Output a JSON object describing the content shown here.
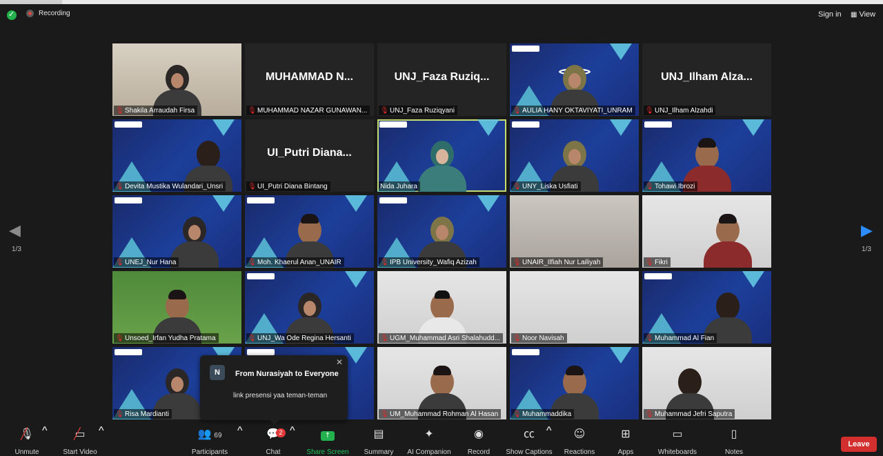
{
  "topbar": {
    "recording_label": "Recording",
    "sign_in_label": "Sign in",
    "view_label": "View",
    "view_icon": "grid-icon"
  },
  "colors": {
    "accent_blue": "#2d8cff",
    "leave_red": "#d32f2f",
    "share_green": "#22b14c",
    "mute_red": "#e02828",
    "active_speaker_border": "#c6de6f"
  },
  "tiles": [
    {
      "name": "Shakila Arraudah Firsa",
      "big": ""
    },
    {
      "name": "MUHAMMAD NAZAR GUNAWAN...",
      "big": "MUHAMMAD  N..."
    },
    {
      "name": "UNJ_Faza Ruziqyani",
      "big": "UNJ_Faza  Ruziq..."
    },
    {
      "name": "AULIA HANY OKTAVIYATI_UNRAM",
      "big": ""
    },
    {
      "name": "UNJ_Ilham Alzahdi",
      "big": "UNJ_Ilham  Alza..."
    },
    {
      "name": "Devita Mustika Wulandari_Unsri",
      "big": ""
    },
    {
      "name": "UI_Putri Diana Bintang",
      "big": "UI_Putri  Diana..."
    },
    {
      "name": "Nida Juhara",
      "big": ""
    },
    {
      "name": "UNY_Liska Usfiati",
      "big": ""
    },
    {
      "name": "Tohawi Ibrozi",
      "big": ""
    },
    {
      "name": "UNEJ_Nur Hana",
      "big": ""
    },
    {
      "name": "Moh. Khaerul Anan_UNAIR",
      "big": ""
    },
    {
      "name": "IPB University_Wafiq Azizah",
      "big": ""
    },
    {
      "name": "UNAIR_Ilfiah Nur Lailiyah",
      "big": ""
    },
    {
      "name": "Fikri",
      "big": ""
    },
    {
      "name": "Unsoed_Irfan Yudha Pratama",
      "big": ""
    },
    {
      "name": "UNJ_Wa Ode Regina Hersanti",
      "big": ""
    },
    {
      "name": "UGM_Muhammad Asri Shalahudd...",
      "big": ""
    },
    {
      "name": "Noor Navisah",
      "big": ""
    },
    {
      "name": "Muhammad Al Fian",
      "big": ""
    },
    {
      "name": "Risa Mardianti",
      "big": ""
    },
    {
      "name": "",
      "big": ""
    },
    {
      "name": "UM_Muhammad Rohman Al Hasan",
      "big": ""
    },
    {
      "name": "Muhammaddika",
      "big": ""
    },
    {
      "name": "Muhammad Jefri Saputra",
      "big": ""
    }
  ],
  "pager": {
    "left_text": "1/3",
    "right_text": "1/3"
  },
  "chat_popup": {
    "avatar_letter": "N",
    "from": "From Nurasiyah to Everyone",
    "message": "link presensi yaa teman-teman"
  },
  "toolbar": {
    "unmute": "Unmute",
    "start_video": "Start Video",
    "participants": "Participants",
    "participants_count": "69",
    "chat": "Chat",
    "chat_badge": "2",
    "share_screen": "Share Screen",
    "summary": "Summary",
    "ai_companion": "AI Companion",
    "record": "Record",
    "show_captions": "Show Captions",
    "reactions": "Reactions",
    "apps": "Apps",
    "whiteboards": "Whiteboards",
    "notes": "Notes",
    "leave": "Leave"
  }
}
